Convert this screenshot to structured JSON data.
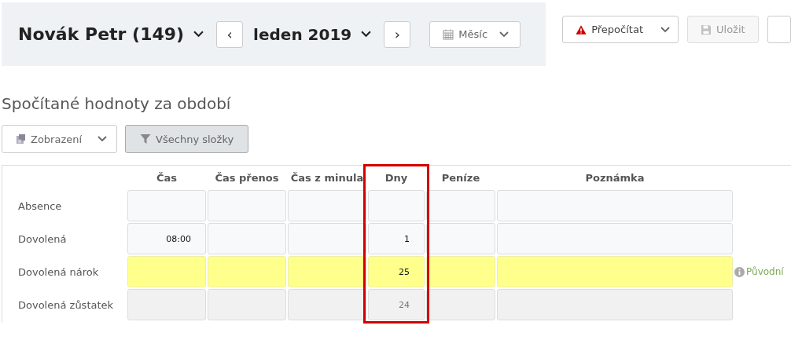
{
  "header": {
    "employee": "Novák Petr (149)",
    "period": "leden 2019",
    "prev_symbol": "‹",
    "next_symbol": "›",
    "view": "Měsíc"
  },
  "actions": [
    {
      "label": "Přepočítat",
      "kind": "warning",
      "disabled": false
    },
    {
      "label": "Uložit",
      "kind": "save",
      "disabled": true
    },
    {
      "kind": "cut"
    }
  ],
  "section_title": "Spočítané hodnoty za období",
  "toolbar": {
    "display": "Zobrazení",
    "filter": "Všechny složky"
  },
  "table": {
    "columns": [
      {
        "label": "Čas",
        "highlighted": false
      },
      {
        "label": "Čas přenos",
        "highlighted": false
      },
      {
        "label": "Čas z minula",
        "highlighted": false
      },
      {
        "label": "Dny",
        "highlighted": true
      },
      {
        "label": "Peníze",
        "highlighted": false
      },
      {
        "label": "Poznámka",
        "highlighted": false
      }
    ],
    "rows": [
      {
        "label": "Absence",
        "kind": "normal",
        "cells": [
          "",
          "",
          "",
          "",
          "",
          ""
        ]
      },
      {
        "label": "Dovolená",
        "kind": "normal",
        "cells": [
          "08:00",
          "",
          "",
          "1",
          "",
          ""
        ]
      },
      {
        "label": "Dovolená nárok",
        "kind": "entitlement",
        "cells": [
          "",
          "",
          "",
          "25",
          "",
          ""
        ],
        "note": "Původní"
      },
      {
        "label": "Dovolená zůstatek",
        "kind": "readonly",
        "cells": [
          "",
          "",
          "",
          "24",
          "",
          ""
        ]
      }
    ]
  }
}
